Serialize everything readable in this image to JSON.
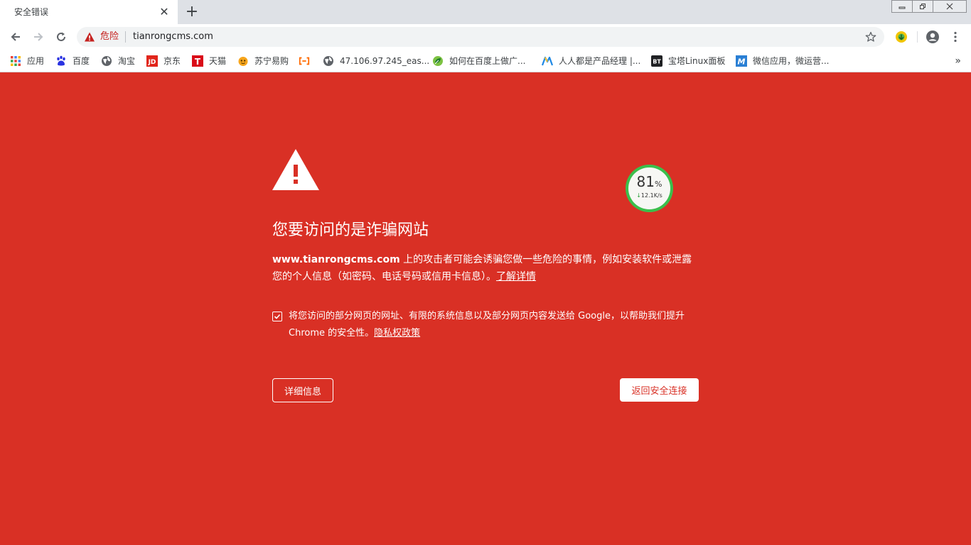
{
  "tab": {
    "title": "安全错误",
    "close_glyph": "✕"
  },
  "new_tab_glyph": "+",
  "window": {
    "minimize": "minimize-icon",
    "restore": "restore-icon",
    "close": "close-icon"
  },
  "omnibox": {
    "danger_label": "危险",
    "url": "tianrongcms.com"
  },
  "bookmarks": [
    {
      "label": "应用",
      "icon": "apps-grid-icon"
    },
    {
      "label": "百度",
      "icon": "baidu-paw-icon"
    },
    {
      "label": "淘宝",
      "icon": "globe-icon"
    },
    {
      "label": "京东",
      "icon": "jd-icon"
    },
    {
      "label": "天猫",
      "icon": "tmall-icon"
    },
    {
      "label": "苏宁易购",
      "icon": "suning-icon"
    },
    {
      "label": "",
      "icon": "aliyun-icon"
    },
    {
      "label": "47.106.97.245_eas...",
      "icon": "globe-icon"
    },
    {
      "label": "如何在百度上做广...",
      "icon": "leaf-icon"
    },
    {
      "label": "人人都是产品经理 |...",
      "icon": "woshipm-icon"
    },
    {
      "label": "宝塔Linux面板",
      "icon": "bt-icon"
    },
    {
      "label": "微信应用，微运营...",
      "icon": "m-icon"
    }
  ],
  "bookmarks_more": "»",
  "interstitial": {
    "heading": "您要访问的是诈骗网站",
    "domain": "www.tianrongcms.com",
    "message": " 上的攻击者可能会诱骗您做一些危险的事情，例如安装软件或泄露您的个人信息（如密码、电话号码或信用卡信息）。",
    "learn_more": "了解详情",
    "checkbox_checked": true,
    "checkbox_text": "将您访问的部分网页的网址、有限的系统信息以及部分网页内容发送给 Google，以帮助我们提升 Chrome 的安全性。",
    "privacy_link": "隐私权政策",
    "details_button": "详细信息",
    "back_button": "返回安全连接"
  },
  "speed_widget": {
    "percent": "81",
    "percent_sign": "%",
    "arrow": "↓",
    "rate": "12.1K/s"
  },
  "colors": {
    "danger_red": "#d93025",
    "white": "#ffffff",
    "chrome_gray": "#dee1e6",
    "speed_green": "#3bbf4c"
  }
}
